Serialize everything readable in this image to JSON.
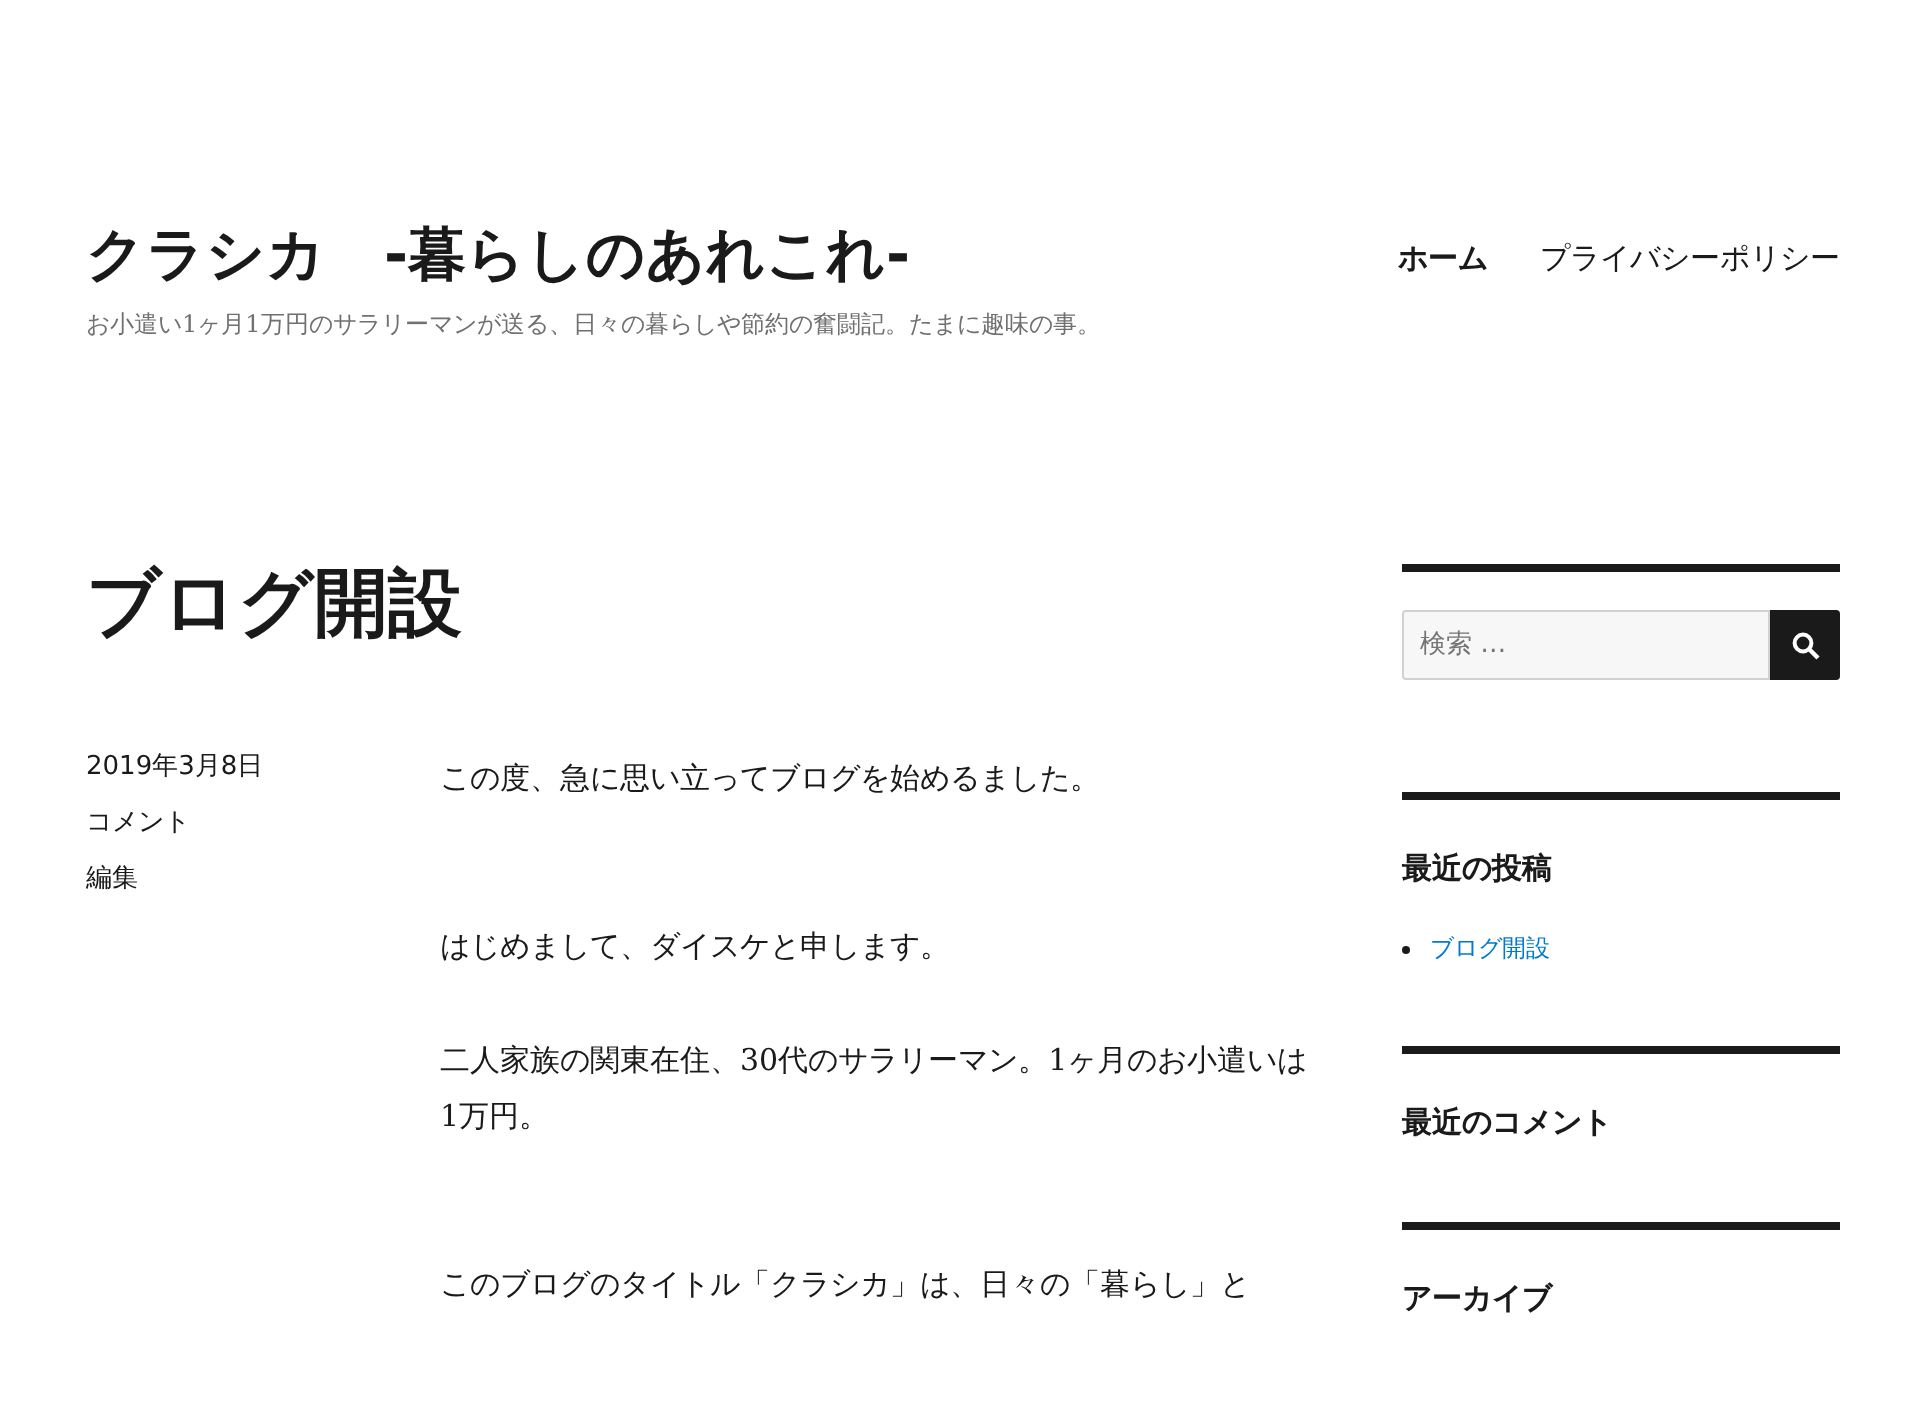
{
  "site": {
    "title": "クラシカ　-暮らしのあれこれ-",
    "tagline": "お小遣い1ヶ月1万円のサラリーマンが送る、日々の暮らしや節約の奮闘記。たまに趣味の事。"
  },
  "nav": [
    {
      "label": "ホーム",
      "selected": true
    },
    {
      "label": "プライバシーポリシー",
      "selected": false
    }
  ],
  "post": {
    "title": "ブログ開設",
    "date": "2019年3月8日",
    "meta_links": [
      "コメント",
      "編集"
    ],
    "paragraphs": [
      "この度、急に思い立ってブログを始めるました。",
      "はじめまして、ダイスケと申します。",
      "二人家族の関東在住、30代のサラリーマン。1ヶ月のお小遣いは1万円。",
      "このブログのタイトル「クラシカ」は、日々の「暮らし」と"
    ]
  },
  "sidebar": {
    "search": {
      "placeholder": "検索 …"
    },
    "widgets": [
      {
        "title": "最近の投稿",
        "items": [
          "ブログ開設"
        ]
      },
      {
        "title": "最近のコメント"
      },
      {
        "title": "アーカイブ"
      }
    ]
  }
}
